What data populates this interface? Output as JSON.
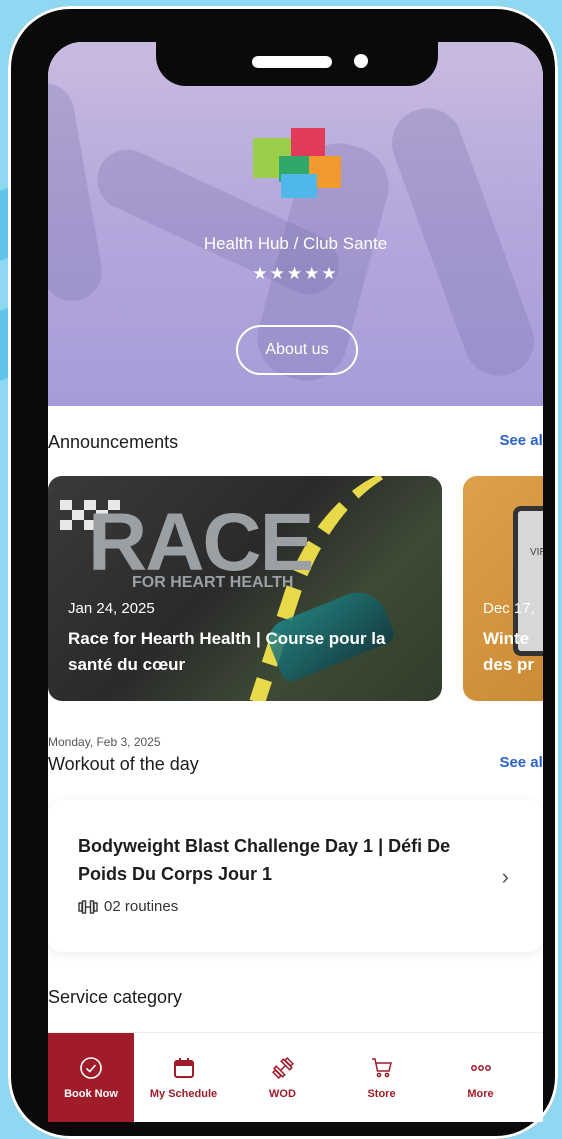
{
  "hero": {
    "club_name": "Health Hub / Club Sante",
    "rating_stars": "★★★★★",
    "about_button": "About us",
    "logo_colors": [
      "#9bcf4a",
      "#e23a5a",
      "#2fa86a",
      "#f29a2e",
      "#4fb8ea"
    ]
  },
  "announcements": {
    "title": "Announcements",
    "see_all": "See all",
    "cards": [
      {
        "image_text": "RACE",
        "image_subtext": "FOR HEART HEALTH",
        "date": "Jan 24, 2025",
        "title": "Race for Hearth Health | Course pour la santé du cœur"
      },
      {
        "image_text": "VIR WEL",
        "date": "Dec 17,",
        "title_line1": "Winte",
        "title_line2": "des pr"
      }
    ]
  },
  "wod": {
    "date": "Monday, Feb 3, 2025",
    "title": "Workout of the day",
    "see_all": "See all",
    "item": {
      "title": "Bodyweight Blast Challenge Day 1 | Défi De Poids Du Corps Jour 1",
      "routines": "02 routines"
    }
  },
  "service": {
    "title": "Service category"
  },
  "nav": {
    "items": [
      {
        "label": "Book Now",
        "icon": "check-circle-icon"
      },
      {
        "label": "My Schedule",
        "icon": "calendar-icon"
      },
      {
        "label": "WOD",
        "icon": "dumbbell-icon"
      },
      {
        "label": "Store",
        "icon": "cart-icon"
      },
      {
        "label": "More",
        "icon": "more-dots-icon"
      }
    ],
    "accent": "#a01c2a"
  }
}
